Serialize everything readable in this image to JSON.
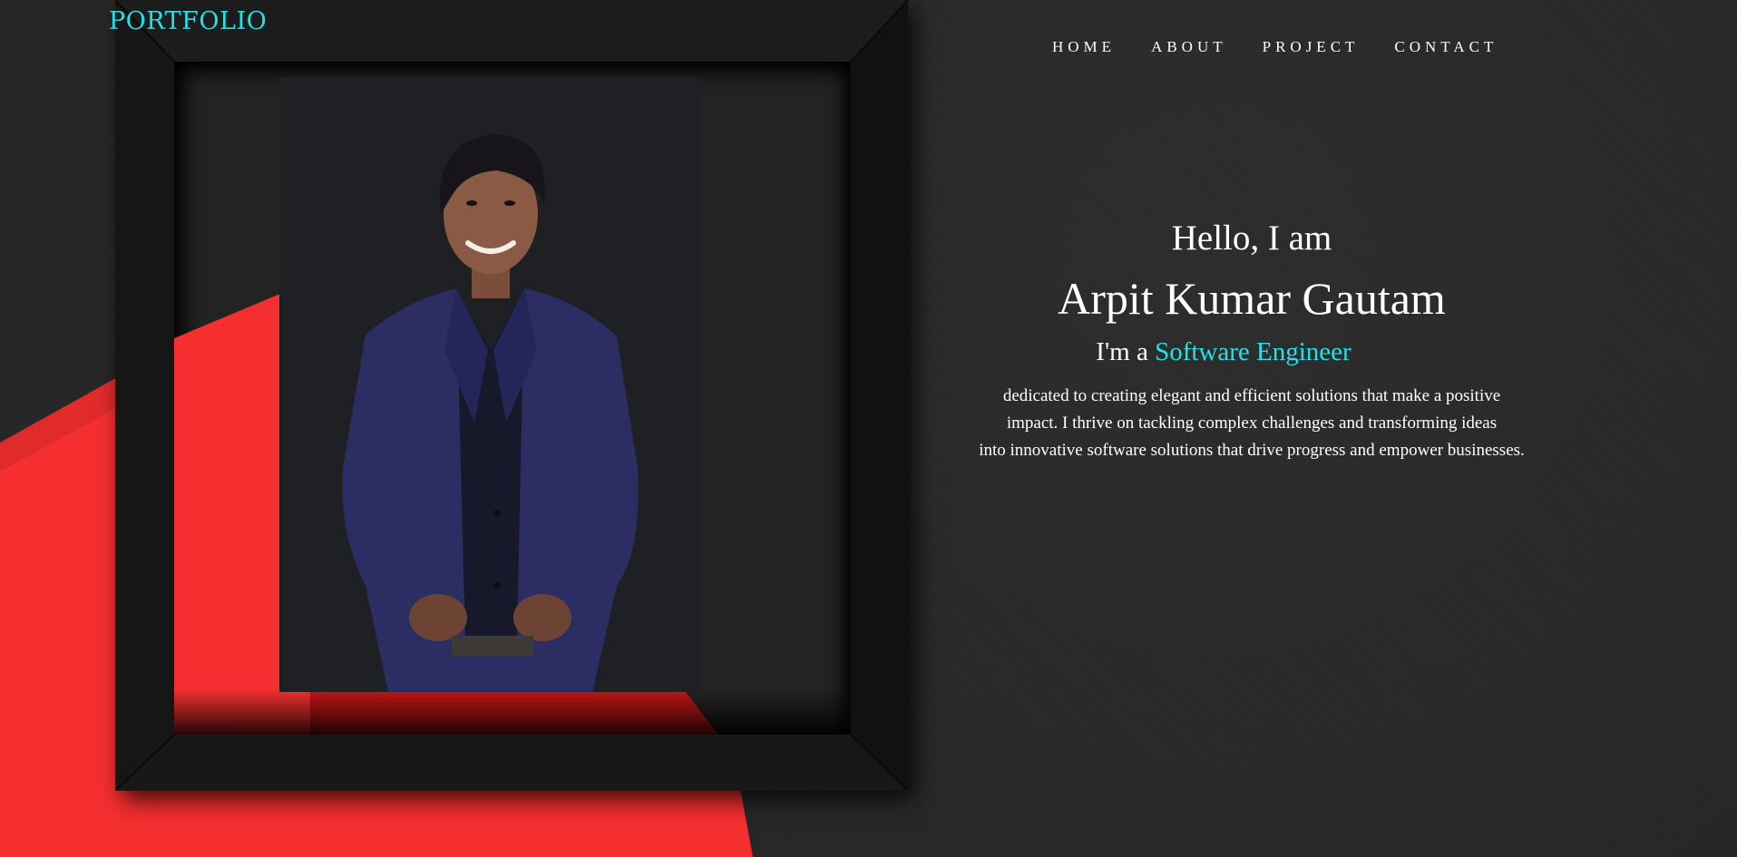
{
  "header": {
    "logo": "PORTFOLIO"
  },
  "nav": {
    "items": [
      "HOME",
      "ABOUT",
      "PROJECT",
      "CONTACT"
    ]
  },
  "hero": {
    "greeting": "Hello, I am",
    "name": "Arpit Kumar Gautam",
    "role_prefix": "I'm a",
    "role_highlight": "Software Engineer",
    "description_lines": [
      "dedicated to creating elegant and efficient solutions that make a positive",
      "impact. I thrive on tackling complex challenges and transforming ideas",
      "into innovative software solutions that drive progress and empower businesses."
    ]
  },
  "colors": {
    "accent": "#1fe3e6",
    "background": "#262626",
    "backdrop_red": "#f52f2f",
    "frame": "#141414",
    "text": "#ffffff"
  },
  "icons": {
    "profile_image": "profile-photo"
  }
}
